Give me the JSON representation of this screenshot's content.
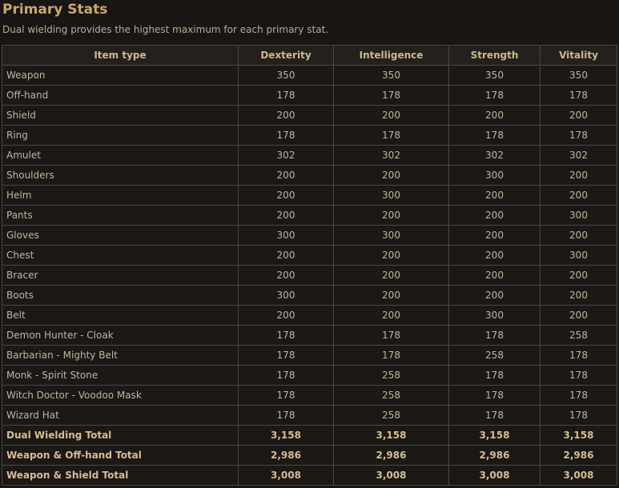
{
  "page": {
    "title": "Primary Stats",
    "subtitle": "Dual wielding provides the highest maximum for each primary stat."
  },
  "table": {
    "headers": [
      "Item type",
      "Dexterity",
      "Intelligence",
      "Strength",
      "Vitality"
    ],
    "rows": [
      [
        "Weapon",
        "350",
        "350",
        "350",
        "350"
      ],
      [
        "Off-hand",
        "178",
        "178",
        "178",
        "178"
      ],
      [
        "Shield",
        "200",
        "200",
        "200",
        "200"
      ],
      [
        "Ring",
        "178",
        "178",
        "178",
        "178"
      ],
      [
        "Amulet",
        "302",
        "302",
        "302",
        "302"
      ],
      [
        "Shoulders",
        "200",
        "200",
        "300",
        "200"
      ],
      [
        "Helm",
        "200",
        "300",
        "200",
        "200"
      ],
      [
        "Pants",
        "200",
        "200",
        "200",
        "300"
      ],
      [
        "Gloves",
        "300",
        "300",
        "200",
        "200"
      ],
      [
        "Chest",
        "200",
        "200",
        "200",
        "300"
      ],
      [
        "Bracer",
        "200",
        "200",
        "200",
        "200"
      ],
      [
        "Boots",
        "300",
        "200",
        "200",
        "200"
      ],
      [
        "Belt",
        "200",
        "200",
        "300",
        "200"
      ],
      [
        "Demon Hunter - Cloak",
        "178",
        "178",
        "178",
        "258"
      ],
      [
        "Barbarian - Mighty Belt",
        "178",
        "178",
        "258",
        "178"
      ],
      [
        "Monk - Spirit Stone",
        "178",
        "258",
        "178",
        "178"
      ],
      [
        "Witch Doctor - Voodoo Mask",
        "178",
        "258",
        "178",
        "178"
      ],
      [
        "Wizard Hat",
        "178",
        "258",
        "178",
        "178"
      ]
    ],
    "totals": [
      [
        "Dual Wielding Total",
        "3,158",
        "3,158",
        "3,158",
        "3,158"
      ],
      [
        "Weapon & Off-hand Total",
        "2,986",
        "2,986",
        "2,986",
        "2,986"
      ],
      [
        "Weapon & Shield Total",
        "3,008",
        "3,008",
        "3,008",
        "3,008"
      ]
    ]
  }
}
